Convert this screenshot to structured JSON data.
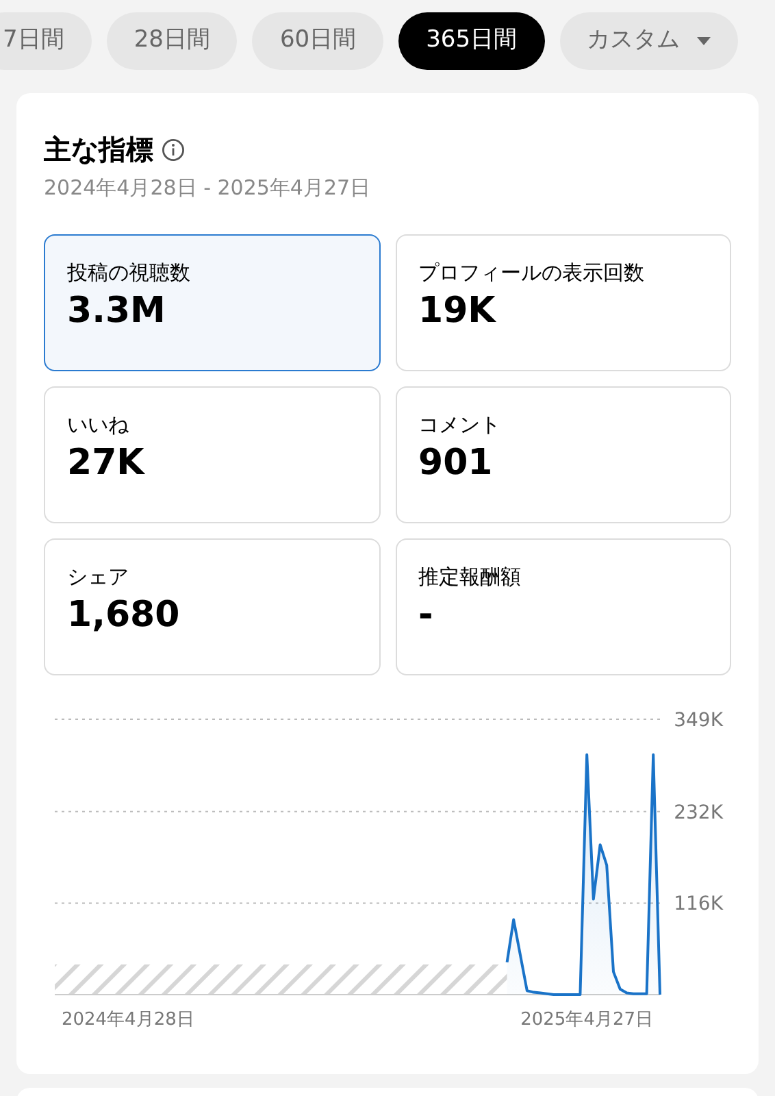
{
  "period_tabs": [
    {
      "label": "7日間",
      "selected": false
    },
    {
      "label": "28日間",
      "selected": false
    },
    {
      "label": "60日間",
      "selected": false
    },
    {
      "label": "365日間",
      "selected": true
    },
    {
      "label": "カスタム",
      "selected": false,
      "kind": "dropdown"
    }
  ],
  "key_metrics": {
    "title": "主な指標",
    "date_range": "2024年4月28日 - 2025年4月27日",
    "metrics": [
      {
        "label": "投稿の視聴数",
        "value": "3.3M",
        "selected": true
      },
      {
        "label": "プロフィールの表示回数",
        "value": "19K",
        "selected": false
      },
      {
        "label": "いいね",
        "value": "27K",
        "selected": false
      },
      {
        "label": "コメント",
        "value": "901",
        "selected": false
      },
      {
        "label": "シェア",
        "value": "1,680",
        "selected": false
      },
      {
        "label": "推定報酬額",
        "value": "-",
        "selected": false
      }
    ],
    "chart_data": {
      "type": "line",
      "ylim": [
        0,
        349
      ],
      "categories": [
        null,
        null,
        null,
        null,
        null,
        null,
        null,
        null,
        null,
        null,
        null,
        "2024年4月28日",
        null,
        null,
        null,
        null,
        null,
        null,
        null,
        null,
        null,
        null,
        null,
        null,
        null,
        null,
        null,
        null,
        null,
        null,
        null,
        null,
        null,
        null,
        null,
        null,
        null,
        null,
        null,
        null,
        null,
        null,
        null,
        null,
        null,
        null,
        null,
        null,
        null,
        null,
        null,
        null,
        null,
        null,
        null,
        null,
        null,
        null,
        null,
        null,
        null,
        null,
        null,
        null,
        null,
        null,
        null,
        null,
        null,
        null,
        null,
        null,
        null,
        null,
        null,
        null,
        null,
        null,
        null,
        null,
        "2025年4月27日",
        null,
        null,
        null,
        null,
        null,
        null,
        null,
        null,
        null,
        null,
        null
      ],
      "yticks": [
        {
          "value": 116,
          "label": "116K"
        },
        {
          "value": 232,
          "label": "232K"
        },
        {
          "value": 349,
          "label": "349K"
        }
      ],
      "series": [
        {
          "color": "#1a73c8",
          "values": [
            null,
            null,
            null,
            null,
            null,
            null,
            null,
            null,
            null,
            null,
            null,
            null,
            null,
            null,
            null,
            null,
            null,
            null,
            null,
            null,
            null,
            null,
            null,
            null,
            null,
            null,
            null,
            null,
            null,
            null,
            null,
            null,
            null,
            null,
            null,
            null,
            null,
            null,
            null,
            null,
            null,
            null,
            null,
            null,
            null,
            null,
            null,
            null,
            null,
            null,
            null,
            null,
            null,
            null,
            null,
            null,
            null,
            null,
            null,
            null,
            null,
            null,
            null,
            null,
            null,
            null,
            null,
            null,
            41,
            95,
            50,
            5,
            3,
            2,
            1,
            0,
            0,
            0,
            0,
            0,
            304,
            121,
            190,
            164,
            29,
            7,
            2,
            1,
            1,
            1,
            304,
            0
          ]
        }
      ]
    }
  }
}
